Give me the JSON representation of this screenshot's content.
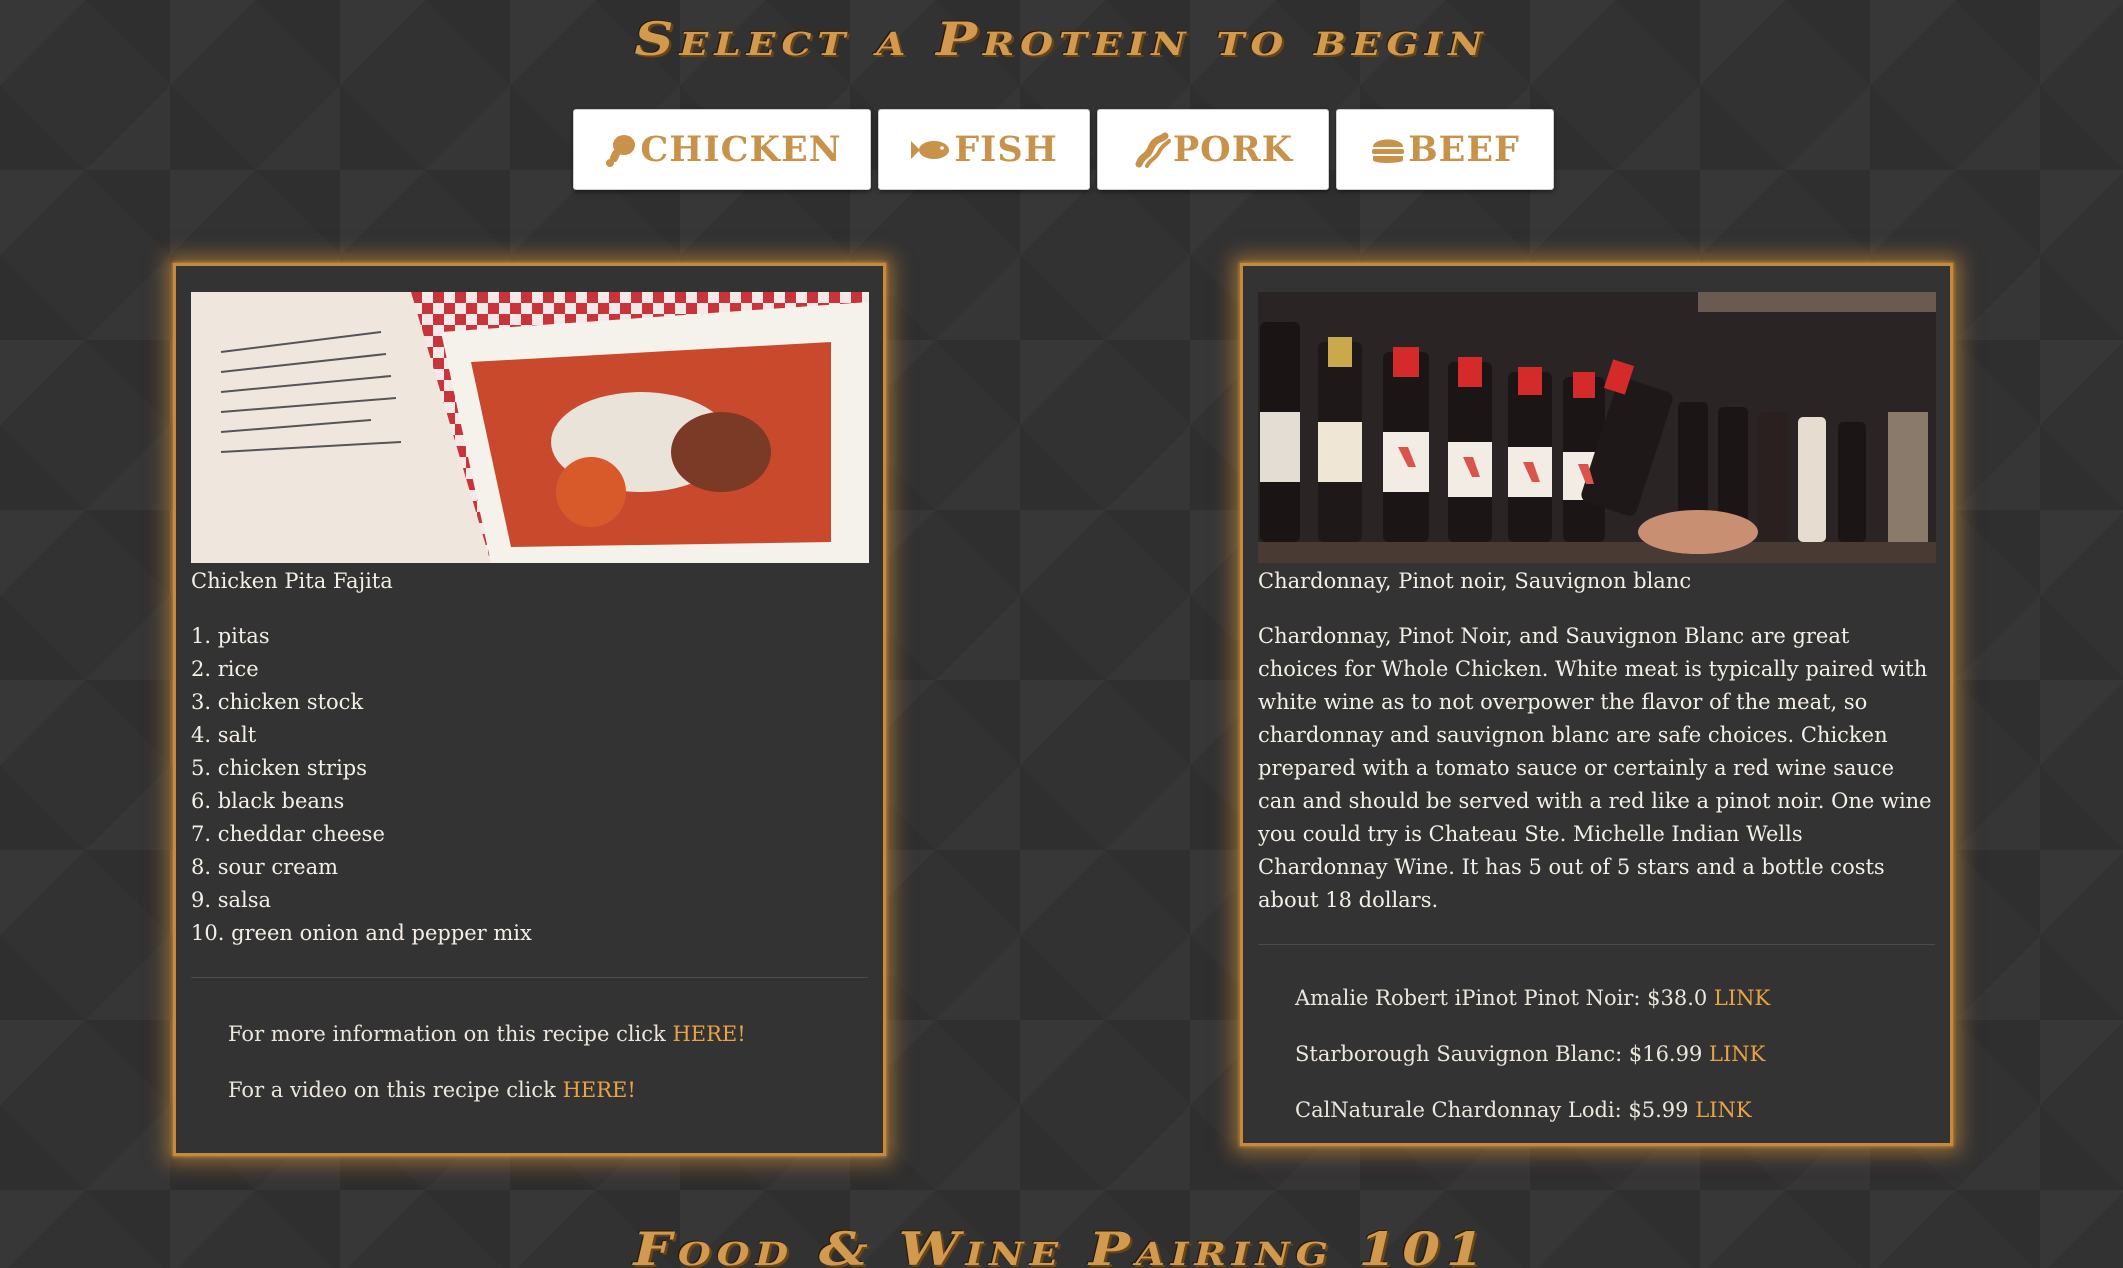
{
  "header": {
    "title": "Select a Protein to begin"
  },
  "proteins": [
    {
      "label": "CHICKEN",
      "icon": "drumstick-icon"
    },
    {
      "label": "FISH",
      "icon": "fish-icon"
    },
    {
      "label": "PORK",
      "icon": "bacon-icon"
    },
    {
      "label": "BEEF",
      "icon": "burger-icon"
    }
  ],
  "recipe": {
    "name": "Chicken Pita Fajita",
    "ingredients": [
      "1. pitas",
      "2. rice",
      "3. chicken stock",
      "4. salt",
      "5. chicken strips",
      "6. black beans",
      "7. cheddar cheese",
      "8. sour cream",
      "9. salsa",
      "10. green onion and pepper mix"
    ],
    "more_info_text": "For more information on this recipe click",
    "more_info_link": "HERE!",
    "video_text": "For a video on this recipe click",
    "video_link": "HERE!"
  },
  "wine": {
    "title": "Chardonnay, Pinot noir, Sauvignon blanc",
    "description": "Chardonnay, Pinot Noir, and Sauvignon Blanc are great choices for Whole Chicken. White meat is typically paired with white wine as to not overpower the flavor of the meat, so chardonnay and sauvignon blanc are safe choices. Chicken prepared with a tomato sauce or certainly a red wine sauce can and should be served with a red like a pinot noir. One wine you could try is Chateau Ste. Michelle Indian Wells Chardonnay Wine. It has 5 out of 5 stars and a bottle costs about 18 dollars.",
    "bottles": [
      {
        "text": "Amalie Robert iPinot Pinot Noir: $38.0",
        "link": "LINK"
      },
      {
        "text": "Starborough Sauvignon Blanc: $16.99",
        "link": "LINK"
      },
      {
        "text": "CalNaturale Chardonnay Lodi: $5.99",
        "link": "LINK"
      }
    ]
  },
  "footer": {
    "title": "Food & Wine Pairing 101"
  },
  "colors": {
    "accent": "#c8924a",
    "link": "#e8a346",
    "background": "#333232"
  }
}
